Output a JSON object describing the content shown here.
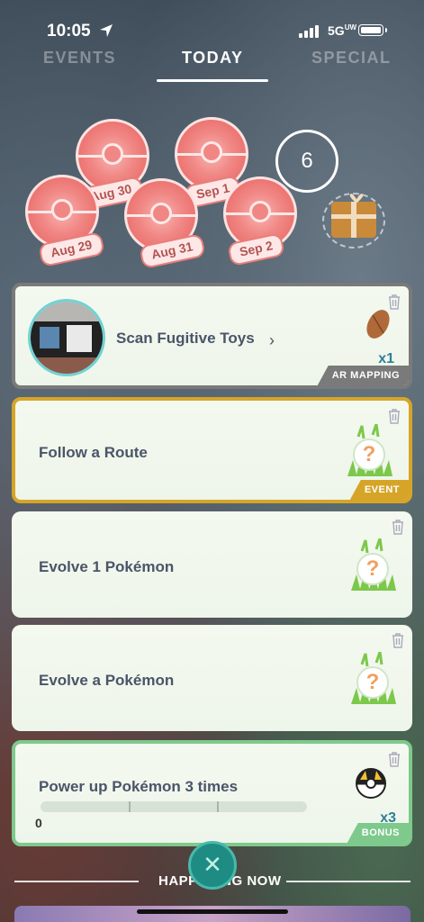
{
  "status_bar": {
    "time": "10:05",
    "network": "5G",
    "network_sub": "UW"
  },
  "tabs": [
    {
      "label": "EVENTS"
    },
    {
      "label": "TODAY"
    },
    {
      "label": "SPECIAL"
    }
  ],
  "daily_stamps": [
    {
      "date": "Aug 29"
    },
    {
      "date": "Aug 30"
    },
    {
      "date": "Aug 31"
    },
    {
      "date": "Sep 1"
    },
    {
      "date": "Sep 2"
    }
  ],
  "streak_count": "6",
  "tasks": [
    {
      "title": "Scan Fugitive Toys",
      "reward_qty": "x1",
      "tag": "AR MAPPING",
      "reward_icon": "nanab-berry-icon"
    },
    {
      "title": "Follow a Route",
      "tag": "EVENT",
      "reward_icon": "mystery-encounter-icon"
    },
    {
      "title": "Evolve 1 Pokémon",
      "reward_icon": "mystery-encounter-icon"
    },
    {
      "title": "Evolve a Pokémon",
      "reward_icon": "mystery-encounter-icon"
    },
    {
      "title": "Power up Pokémon 3 times",
      "reward_qty": "x3",
      "tag": "BONUS",
      "progress_value": "0",
      "progress_fraction": 0,
      "reward_icon": "ultra-ball-icon"
    }
  ],
  "section_label": "HAPPENING NOW",
  "colors": {
    "ar_border": "#7a7a7a",
    "event_border": "#d6a528",
    "bonus_border": "#7ec98c",
    "accent_teal": "#1f8c84"
  }
}
